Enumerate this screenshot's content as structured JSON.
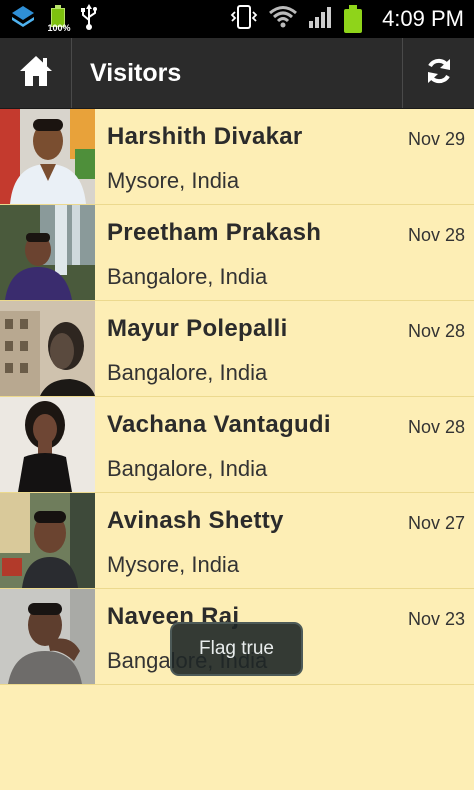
{
  "status_bar": {
    "time": "4:09 PM",
    "battery_percent_label": "100%",
    "icons": [
      "app-notification-icon",
      "battery-full-icon",
      "usb-icon",
      "vibrate-icon",
      "wifi-icon",
      "signal-icon",
      "battery-icon"
    ]
  },
  "action_bar": {
    "title": "Visitors",
    "home_icon": "home-icon",
    "refresh_icon": "refresh-icon",
    "background_color": "#2b2b2b"
  },
  "visitors": [
    {
      "name": "Harshith Divakar",
      "location": "Mysore, India",
      "date": "Nov 29"
    },
    {
      "name": "Preetham Prakash",
      "location": "Bangalore, India",
      "date": "Nov 28"
    },
    {
      "name": "Mayur Polepalli",
      "location": "Bangalore, India",
      "date": "Nov 28"
    },
    {
      "name": "Vachana Vantagudi",
      "location": "Bangalore, India",
      "date": "Nov 28"
    },
    {
      "name": "Avinash Shetty",
      "location": "Mysore, India",
      "date": "Nov 27"
    },
    {
      "name": "Naveen Raj",
      "location": "Bangalore, India",
      "date": "Nov 23"
    }
  ],
  "toast": {
    "message": "Flag true"
  },
  "colors": {
    "list_background": "#fdeeb5",
    "row_divider": "#ecd98e",
    "accent_battery": "#8fd41a"
  }
}
